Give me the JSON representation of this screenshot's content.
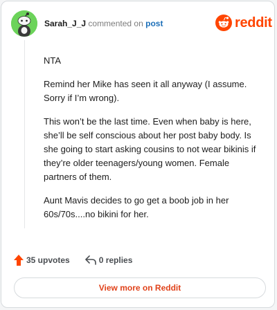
{
  "header": {
    "username": "Sarah_J_J",
    "action_text": "commented on",
    "post_link": "post",
    "brand": "reddit"
  },
  "comment": {
    "paragraphs": [
      "NTA",
      "Remind her Mike has seen it all anyway (I assume. Sorry if I’m wrong).",
      "This won’t be the last time. Even when baby is here, she’ll be self conscious about her post baby body. Is she going to start asking cousins to not wear bikinis if they’re older teenagers/young women. Female partners of them.",
      "Aunt Mavis decides to go get a boob job in her 60s/70s....no bikini for her."
    ]
  },
  "footer": {
    "upvotes": "35 upvotes",
    "replies": "0 replies",
    "view_more": "View more on Reddit"
  },
  "icons": {
    "upvote": "upvote-arrow-icon",
    "reply": "reply-icon",
    "brand": "reddit-snoo-icon",
    "avatar": "snoo-avatar-icon"
  },
  "colors": {
    "brand": "#ff4500",
    "avatar_bg": "#6cd35a",
    "link": "#1c6fb8"
  }
}
